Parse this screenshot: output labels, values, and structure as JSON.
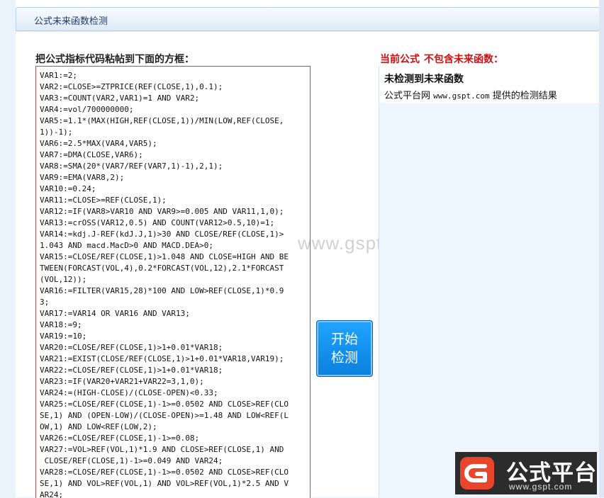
{
  "window": {
    "title": "公式未来函数检测"
  },
  "left": {
    "heading": "把公式指标代码粘帖到下面的方框：",
    "code_lines": [
      "VAR1:=2;",
      "VAR2:=CLOSE>=ZTPRICE(REF(CLOSE,1),0.1);",
      "VAR3:=COUNT(VAR2,VAR1)=1 AND VAR2;",
      "VAR4:=vol/700000000;",
      "VAR5:=1.1*(MAX(HIGH,REF(CLOSE,1))/MIN(LOW,REF(CLOSE,",
      "1))-1);",
      "VAR6:=2.5*MAX(VAR4,VAR5);",
      "VAR7:=DMA(CLOSE,VAR6);",
      "VAR8:=SMA(20*(VAR7/REF(VAR7,1)-1),2,1);",
      "VAR9:=EMA(VAR8,2);",
      "VAR10:=0.24;",
      "VAR11:=CLOSE>=REF(CLOSE,1);",
      "VAR12:=IF(VAR8>VAR10 AND VAR9>=0.005 AND VAR11,1,0);",
      "VAR13:=crOSS(VAR12,0.5) AND COUNT(VAR12>0.5,10)=1;",
      "VAR14:=kdj.J-REF(kdJ.J,1)>30 AND CLOSE/REF(CLOSE,1)>",
      "1.043 AND macd.MacD>0 AND MACD.DEA>0;",
      "VAR15:=CLOSE/REF(CLOSE,1)>1.048 AND CLOSE=HIGH AND BE",
      "TWEEN(FORCAST(VOL,4),0.2*FORCAST(VOL,12),2.1*FORCAST",
      "(VOL,12));",
      "VAR16:=FILTER(VAR15,28)*100 AND LOW>REF(CLOSE,1)*0.9",
      "3;",
      "VAR17:=VAR14 OR VAR16 AND VAR13;",
      "VAR18:=9;",
      "VAR19:=10;",
      "VAR20:=CLOSE/REF(CLOSE,1)>1+0.01*VAR18;",
      "VAR21:=EXIST(CLOSE/REF(CLOSE,1)>1+0.01*VAR18,VAR19);",
      "VAR22:=CLOSE/REF(CLOSE,1)>1+0.01*VAR18;",
      "VAR23:=IF(VAR20+VAR21+VAR22=3,1,0);",
      "VAR24:=(HIGH-CLOSE)/(CLOSE-OPEN)<0.33;",
      "VAR25:=CLOSE/REF(CLOSE,1)-1>=0.0502 AND CLOSE>REF(CLO",
      "SE,1) AND (OPEN-LOW)/(CLOSE-OPEN)>=1.48 AND LOW<REF(L",
      "OW,1) AND LOW<REF(LOW,2);",
      "VAR26:=CLOSE/REF(CLOSE,1)-1>=0.08;",
      "VAR27:=VOL>REF(VOL,1)*1.9 AND CLOSE>REF(CLOSE,1) AND",
      " CLOSE/REF(CLOSE,1)-1>=0.049 AND VAR24;",
      "VAR28:=CLOSE/REF(CLOSE,1)-1>=0.0502 AND CLOSE>REF(CLO",
      "SE,1) AND VOL>REF(VOL,1) AND VOL>REF(VOL,1)*2.5 AND V",
      "AR24;"
    ],
    "watermark": "www.gspt.com"
  },
  "action": {
    "start_label_line1": "开始",
    "start_label_line2": "检测"
  },
  "right": {
    "heading_part1": "当前公式",
    "heading_part2": "不包含未来函数：",
    "result_title": "未检测到未来函数",
    "result_detail_prefix": "公式平台网",
    "result_detail_url": "www.gspt.com",
    "result_detail_suffix": "提供的检测结果"
  },
  "logo": {
    "name": "公式平台",
    "url": "www.gspt.com"
  },
  "colors": {
    "accent_red": "#cc1111",
    "button_blue": "#0b7fde",
    "code_border": "#b05050"
  }
}
